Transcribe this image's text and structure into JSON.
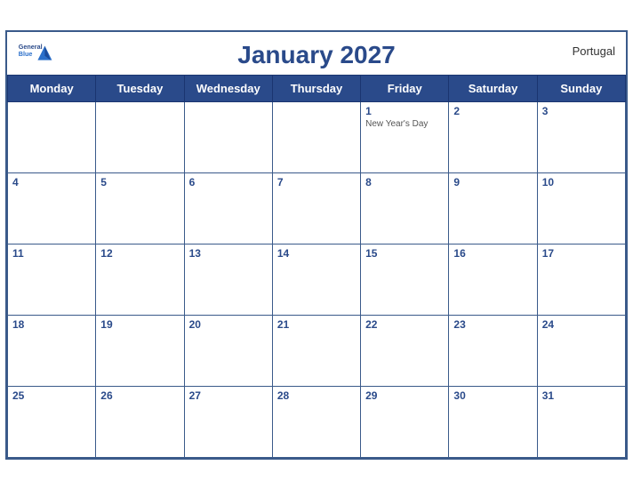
{
  "header": {
    "title": "January 2027",
    "brand": "General\nBlue",
    "country": "Portugal"
  },
  "weekdays": [
    "Monday",
    "Tuesday",
    "Wednesday",
    "Thursday",
    "Friday",
    "Saturday",
    "Sunday"
  ],
  "weeks": [
    [
      {
        "day": "",
        "empty": true
      },
      {
        "day": "",
        "empty": true
      },
      {
        "day": "",
        "empty": true
      },
      {
        "day": "",
        "empty": true
      },
      {
        "day": "1",
        "holiday": "New Year's Day"
      },
      {
        "day": "2",
        "empty": false
      },
      {
        "day": "3",
        "empty": false
      }
    ],
    [
      {
        "day": "4"
      },
      {
        "day": "5"
      },
      {
        "day": "6"
      },
      {
        "day": "7"
      },
      {
        "day": "8"
      },
      {
        "day": "9"
      },
      {
        "day": "10"
      }
    ],
    [
      {
        "day": "11"
      },
      {
        "day": "12"
      },
      {
        "day": "13"
      },
      {
        "day": "14"
      },
      {
        "day": "15"
      },
      {
        "day": "16"
      },
      {
        "day": "17"
      }
    ],
    [
      {
        "day": "18"
      },
      {
        "day": "19"
      },
      {
        "day": "20"
      },
      {
        "day": "21"
      },
      {
        "day": "22"
      },
      {
        "day": "23"
      },
      {
        "day": "24"
      }
    ],
    [
      {
        "day": "25"
      },
      {
        "day": "26"
      },
      {
        "day": "27"
      },
      {
        "day": "28"
      },
      {
        "day": "29"
      },
      {
        "day": "30"
      },
      {
        "day": "31"
      }
    ]
  ]
}
